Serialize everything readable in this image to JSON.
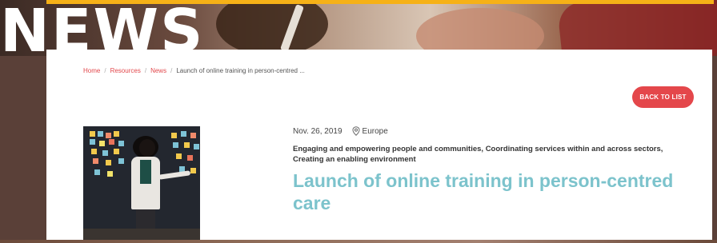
{
  "hero": {
    "title": "NEWS"
  },
  "breadcrumb": [
    {
      "label": "Home"
    },
    {
      "label": "Resources"
    },
    {
      "label": "News"
    },
    {
      "label": "Launch of online training in person-centred ..."
    }
  ],
  "back_button": {
    "label": "BACK TO LIST"
  },
  "article": {
    "date": "Nov. 26, 2019",
    "location": "Europe",
    "tags": "Engaging and empowering people and communities, Coordinating services within and across sectors, Creating an enabling environment",
    "title": "Launch of online training in person-centred care"
  },
  "colors": {
    "accent_red": "#e4474b",
    "title_teal": "#7cc3cc",
    "top_bar_yellow": "#f6b117"
  },
  "icons": {
    "location": "map-pin-icon"
  }
}
